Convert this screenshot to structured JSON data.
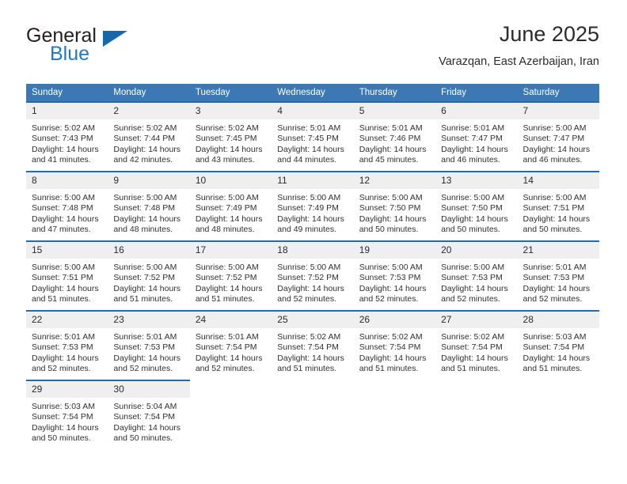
{
  "brand": {
    "line1": "General",
    "line2": "Blue",
    "accent_color": "#1668ab",
    "text_color": "#231f20"
  },
  "header": {
    "title": "June 2025",
    "subtitle": "Varazqan, East Azerbaijan, Iran"
  },
  "calendar": {
    "header_bg": "#3b78b4",
    "row_border_color": "#1f6cb0",
    "daynum_bg": "#efefef",
    "weekday_headers": [
      "Sunday",
      "Monday",
      "Tuesday",
      "Wednesday",
      "Thursday",
      "Friday",
      "Saturday"
    ],
    "weeks": [
      [
        {
          "day": "1",
          "sunrise": "Sunrise: 5:02 AM",
          "sunset": "Sunset: 7:43 PM",
          "daylight_line1": "Daylight: 14 hours",
          "daylight_line2": "and 41 minutes."
        },
        {
          "day": "2",
          "sunrise": "Sunrise: 5:02 AM",
          "sunset": "Sunset: 7:44 PM",
          "daylight_line1": "Daylight: 14 hours",
          "daylight_line2": "and 42 minutes."
        },
        {
          "day": "3",
          "sunrise": "Sunrise: 5:02 AM",
          "sunset": "Sunset: 7:45 PM",
          "daylight_line1": "Daylight: 14 hours",
          "daylight_line2": "and 43 minutes."
        },
        {
          "day": "4",
          "sunrise": "Sunrise: 5:01 AM",
          "sunset": "Sunset: 7:45 PM",
          "daylight_line1": "Daylight: 14 hours",
          "daylight_line2": "and 44 minutes."
        },
        {
          "day": "5",
          "sunrise": "Sunrise: 5:01 AM",
          "sunset": "Sunset: 7:46 PM",
          "daylight_line1": "Daylight: 14 hours",
          "daylight_line2": "and 45 minutes."
        },
        {
          "day": "6",
          "sunrise": "Sunrise: 5:01 AM",
          "sunset": "Sunset: 7:47 PM",
          "daylight_line1": "Daylight: 14 hours",
          "daylight_line2": "and 46 minutes."
        },
        {
          "day": "7",
          "sunrise": "Sunrise: 5:00 AM",
          "sunset": "Sunset: 7:47 PM",
          "daylight_line1": "Daylight: 14 hours",
          "daylight_line2": "and 46 minutes."
        }
      ],
      [
        {
          "day": "8",
          "sunrise": "Sunrise: 5:00 AM",
          "sunset": "Sunset: 7:48 PM",
          "daylight_line1": "Daylight: 14 hours",
          "daylight_line2": "and 47 minutes."
        },
        {
          "day": "9",
          "sunrise": "Sunrise: 5:00 AM",
          "sunset": "Sunset: 7:48 PM",
          "daylight_line1": "Daylight: 14 hours",
          "daylight_line2": "and 48 minutes."
        },
        {
          "day": "10",
          "sunrise": "Sunrise: 5:00 AM",
          "sunset": "Sunset: 7:49 PM",
          "daylight_line1": "Daylight: 14 hours",
          "daylight_line2": "and 48 minutes."
        },
        {
          "day": "11",
          "sunrise": "Sunrise: 5:00 AM",
          "sunset": "Sunset: 7:49 PM",
          "daylight_line1": "Daylight: 14 hours",
          "daylight_line2": "and 49 minutes."
        },
        {
          "day": "12",
          "sunrise": "Sunrise: 5:00 AM",
          "sunset": "Sunset: 7:50 PM",
          "daylight_line1": "Daylight: 14 hours",
          "daylight_line2": "and 50 minutes."
        },
        {
          "day": "13",
          "sunrise": "Sunrise: 5:00 AM",
          "sunset": "Sunset: 7:50 PM",
          "daylight_line1": "Daylight: 14 hours",
          "daylight_line2": "and 50 minutes."
        },
        {
          "day": "14",
          "sunrise": "Sunrise: 5:00 AM",
          "sunset": "Sunset: 7:51 PM",
          "daylight_line1": "Daylight: 14 hours",
          "daylight_line2": "and 50 minutes."
        }
      ],
      [
        {
          "day": "15",
          "sunrise": "Sunrise: 5:00 AM",
          "sunset": "Sunset: 7:51 PM",
          "daylight_line1": "Daylight: 14 hours",
          "daylight_line2": "and 51 minutes."
        },
        {
          "day": "16",
          "sunrise": "Sunrise: 5:00 AM",
          "sunset": "Sunset: 7:52 PM",
          "daylight_line1": "Daylight: 14 hours",
          "daylight_line2": "and 51 minutes."
        },
        {
          "day": "17",
          "sunrise": "Sunrise: 5:00 AM",
          "sunset": "Sunset: 7:52 PM",
          "daylight_line1": "Daylight: 14 hours",
          "daylight_line2": "and 51 minutes."
        },
        {
          "day": "18",
          "sunrise": "Sunrise: 5:00 AM",
          "sunset": "Sunset: 7:52 PM",
          "daylight_line1": "Daylight: 14 hours",
          "daylight_line2": "and 52 minutes."
        },
        {
          "day": "19",
          "sunrise": "Sunrise: 5:00 AM",
          "sunset": "Sunset: 7:53 PM",
          "daylight_line1": "Daylight: 14 hours",
          "daylight_line2": "and 52 minutes."
        },
        {
          "day": "20",
          "sunrise": "Sunrise: 5:00 AM",
          "sunset": "Sunset: 7:53 PM",
          "daylight_line1": "Daylight: 14 hours",
          "daylight_line2": "and 52 minutes."
        },
        {
          "day": "21",
          "sunrise": "Sunrise: 5:01 AM",
          "sunset": "Sunset: 7:53 PM",
          "daylight_line1": "Daylight: 14 hours",
          "daylight_line2": "and 52 minutes."
        }
      ],
      [
        {
          "day": "22",
          "sunrise": "Sunrise: 5:01 AM",
          "sunset": "Sunset: 7:53 PM",
          "daylight_line1": "Daylight: 14 hours",
          "daylight_line2": "and 52 minutes."
        },
        {
          "day": "23",
          "sunrise": "Sunrise: 5:01 AM",
          "sunset": "Sunset: 7:53 PM",
          "daylight_line1": "Daylight: 14 hours",
          "daylight_line2": "and 52 minutes."
        },
        {
          "day": "24",
          "sunrise": "Sunrise: 5:01 AM",
          "sunset": "Sunset: 7:54 PM",
          "daylight_line1": "Daylight: 14 hours",
          "daylight_line2": "and 52 minutes."
        },
        {
          "day": "25",
          "sunrise": "Sunrise: 5:02 AM",
          "sunset": "Sunset: 7:54 PM",
          "daylight_line1": "Daylight: 14 hours",
          "daylight_line2": "and 51 minutes."
        },
        {
          "day": "26",
          "sunrise": "Sunrise: 5:02 AM",
          "sunset": "Sunset: 7:54 PM",
          "daylight_line1": "Daylight: 14 hours",
          "daylight_line2": "and 51 minutes."
        },
        {
          "day": "27",
          "sunrise": "Sunrise: 5:02 AM",
          "sunset": "Sunset: 7:54 PM",
          "daylight_line1": "Daylight: 14 hours",
          "daylight_line2": "and 51 minutes."
        },
        {
          "day": "28",
          "sunrise": "Sunrise: 5:03 AM",
          "sunset": "Sunset: 7:54 PM",
          "daylight_line1": "Daylight: 14 hours",
          "daylight_line2": "and 51 minutes."
        }
      ],
      [
        {
          "day": "29",
          "sunrise": "Sunrise: 5:03 AM",
          "sunset": "Sunset: 7:54 PM",
          "daylight_line1": "Daylight: 14 hours",
          "daylight_line2": "and 50 minutes."
        },
        {
          "day": "30",
          "sunrise": "Sunrise: 5:04 AM",
          "sunset": "Sunset: 7:54 PM",
          "daylight_line1": "Daylight: 14 hours",
          "daylight_line2": "and 50 minutes."
        },
        {
          "day": "",
          "sunrise": "",
          "sunset": "",
          "daylight_line1": "",
          "daylight_line2": ""
        },
        {
          "day": "",
          "sunrise": "",
          "sunset": "",
          "daylight_line1": "",
          "daylight_line2": ""
        },
        {
          "day": "",
          "sunrise": "",
          "sunset": "",
          "daylight_line1": "",
          "daylight_line2": ""
        },
        {
          "day": "",
          "sunrise": "",
          "sunset": "",
          "daylight_line1": "",
          "daylight_line2": ""
        },
        {
          "day": "",
          "sunrise": "",
          "sunset": "",
          "daylight_line1": "",
          "daylight_line2": ""
        }
      ]
    ]
  }
}
